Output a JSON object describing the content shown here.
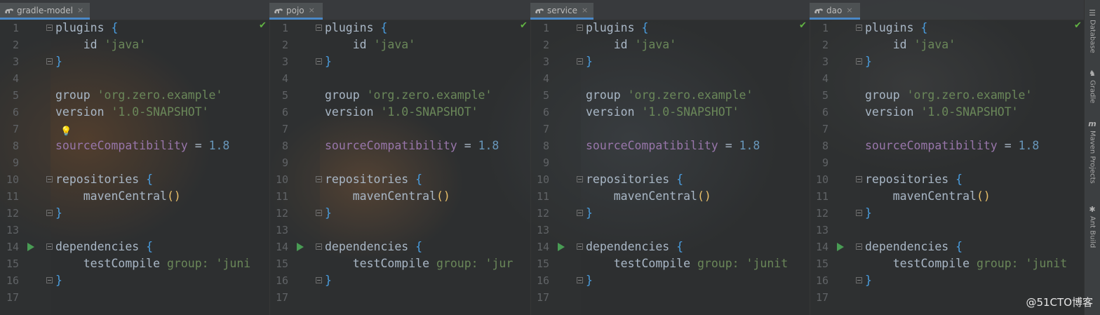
{
  "panes": [
    {
      "tab": "gradle-model",
      "visible_line15": "testCompile group: 'juni",
      "bulb": true
    },
    {
      "tab": "pojo",
      "visible_line15": "testCompile group: 'jur",
      "bulb": false
    },
    {
      "tab": "service",
      "visible_line15": "testCompile group: 'junit",
      "bulb": false
    },
    {
      "tab": "dao",
      "visible_line15": "testCompile group: 'junit",
      "bulb": false
    }
  ],
  "tab_close_glyph": "×",
  "line_numbers": [
    "1",
    "2",
    "3",
    "4",
    "5",
    "6",
    "7",
    "8",
    "9",
    "10",
    "11",
    "12",
    "13",
    "14",
    "15",
    "16",
    "17"
  ],
  "code": {
    "l1_kw": "plugins",
    "l1_brace": "{",
    "l2_id": "id",
    "l2_str": "'java'",
    "l3_brace": "}",
    "l5_kw": "group",
    "l5_str": "'org.zero.example'",
    "l6_kw": "version",
    "l6_str": "'1.0-SNAPSHOT'",
    "l8_prop": "sourceCompatibility",
    "l8_eq": "=",
    "l8_num": "1.8",
    "l10_kw": "repositories",
    "l10_brace": "{",
    "l11_call": "mavenCentral",
    "l11_paren": "()",
    "l12_brace": "}",
    "l14_kw": "dependencies",
    "l14_brace": "{",
    "l15_kw": "testCompile",
    "l15_named": "group:",
    "l16_brace": "}"
  },
  "sidebar": {
    "items": [
      {
        "label": "Database",
        "icon": "database-icon"
      },
      {
        "label": "Gradle",
        "icon": "gradle-icon"
      },
      {
        "label": "Maven Projects",
        "icon": "maven-icon"
      },
      {
        "label": "Ant Build",
        "icon": "ant-icon"
      }
    ]
  },
  "watermark": "@51CTO博客",
  "colors": {
    "keyword": "#a9b7c6",
    "string": "#6a8759",
    "property": "#9876aa",
    "number": "#6897bb",
    "brace": "#4a9ee0",
    "paren": "#e8bf6a",
    "run_gutter": "#499c54",
    "check": "#62b543",
    "tab_underline": "#4a88c7"
  }
}
